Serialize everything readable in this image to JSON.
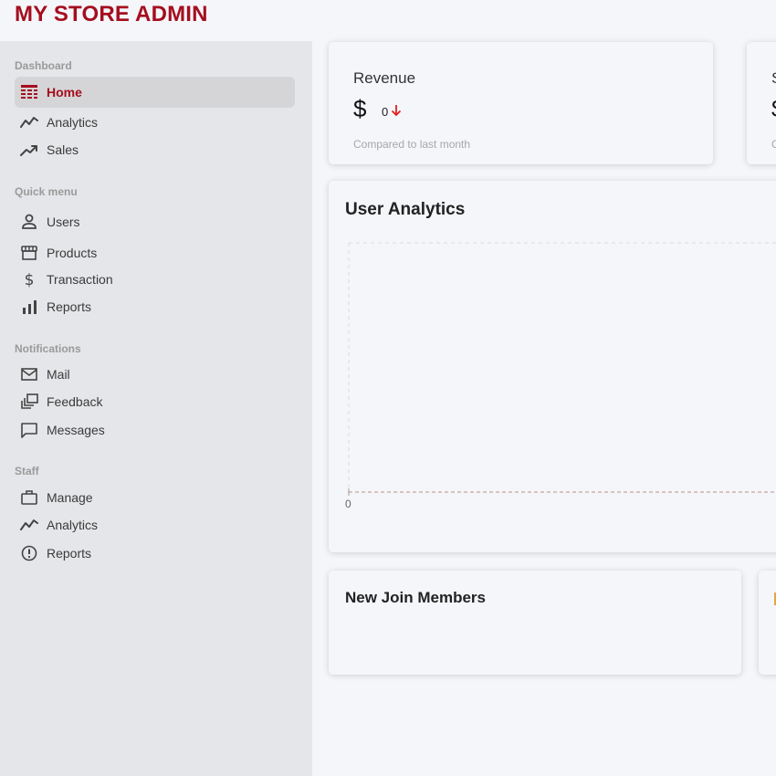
{
  "brand": {
    "title": "MY STORE ADMIN"
  },
  "sidebar": {
    "sections": [
      {
        "title": "Dashboard"
      },
      {
        "title": "Quick menu"
      },
      {
        "title": "Notifications"
      },
      {
        "title": "Staff"
      }
    ],
    "items": [
      {
        "label": "Home",
        "icon": "home-icon",
        "active": true
      },
      {
        "label": "Analytics",
        "icon": "timeline-icon"
      },
      {
        "label": "Sales",
        "icon": "trending-up-icon"
      },
      {
        "label": "Users",
        "icon": "user-icon"
      },
      {
        "label": "Products",
        "icon": "storefront-icon"
      },
      {
        "label": "Transaction",
        "icon": "dollar-icon"
      },
      {
        "label": "Reports",
        "icon": "bar-chart-icon"
      },
      {
        "label": "Mail",
        "icon": "mail-icon"
      },
      {
        "label": "Feedback",
        "icon": "dynamic-feed-icon"
      },
      {
        "label": "Messages",
        "icon": "chat-bubble-icon"
      },
      {
        "label": "Manage",
        "icon": "work-outline-icon"
      },
      {
        "label": "Analytics",
        "icon": "timeline-icon"
      },
      {
        "label": "Reports",
        "icon": "report-icon"
      }
    ]
  },
  "featured": {
    "revenue": {
      "title": "Revenue",
      "currency": "$",
      "rate": "0",
      "trend_icon": "arrow-down-icon",
      "subtitle": "Compared to last month"
    },
    "second": {
      "title": "S",
      "currency": "$",
      "subtitle": "C"
    }
  },
  "analytics": {
    "title": "User Analytics",
    "chart_data": {
      "type": "line",
      "x": [],
      "series": [
        {
          "values": []
        }
      ],
      "tick_labels": [
        "0"
      ],
      "grid": true
    }
  },
  "widgets": {
    "new_members": {
      "title": "New Join Members"
    }
  },
  "colors": {
    "brand": "#a50e1e",
    "sidebar_bg": "#e5e6e9",
    "page_bg": "#f4f6fa",
    "trend_down": "#e0201b",
    "line": "#c8a79b"
  }
}
